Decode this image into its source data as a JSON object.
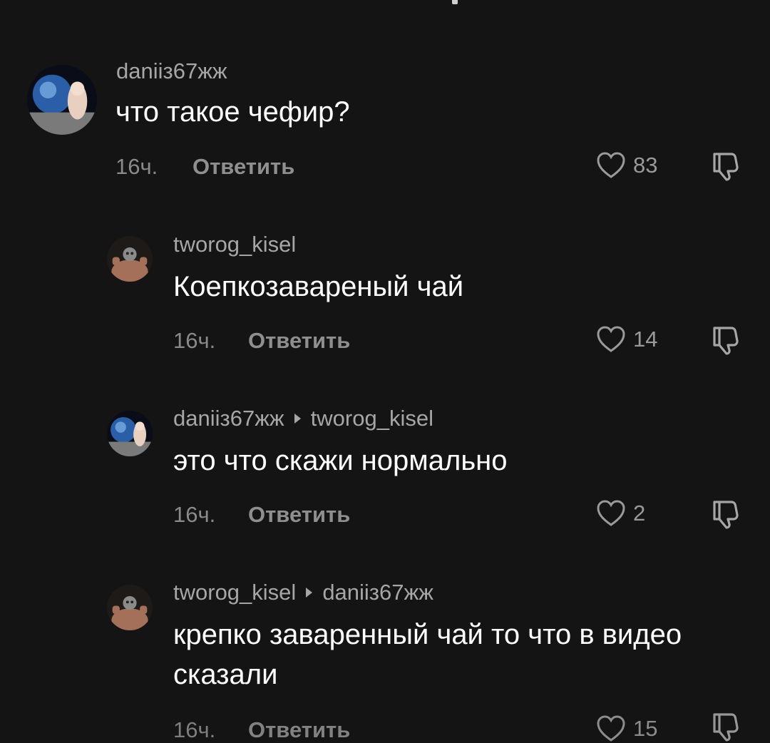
{
  "comments": [
    {
      "username": "daniiз67жж",
      "reply_to": "",
      "text": "что такое чефир?",
      "time": "16ч.",
      "reply_label": "Ответить",
      "likes": "83"
    },
    {
      "username": "tworog_kisel",
      "reply_to": "",
      "text": "Коепкозавареный чай",
      "time": "16ч.",
      "reply_label": "Ответить",
      "likes": "14"
    },
    {
      "username": "daniiз67жж",
      "reply_to": "tworog_kisel",
      "text": "это что скажи нормально",
      "time": "16ч.",
      "reply_label": "Ответить",
      "likes": "2"
    },
    {
      "username": "tworog_kisel",
      "reply_to": "daniiз67жж",
      "text": "крепко заваренный чай то что в видео сказали",
      "time": "16ч.",
      "reply_label": "Ответить",
      "likes": "15"
    }
  ],
  "icons": {
    "like": "heart-outline-icon",
    "dislike": "thumbs-down-outline-icon",
    "reply_arrow": "caret-right-icon"
  },
  "colors": {
    "background": "#141414",
    "text": "#ffffff",
    "secondary_text": "#a6a6a6"
  }
}
